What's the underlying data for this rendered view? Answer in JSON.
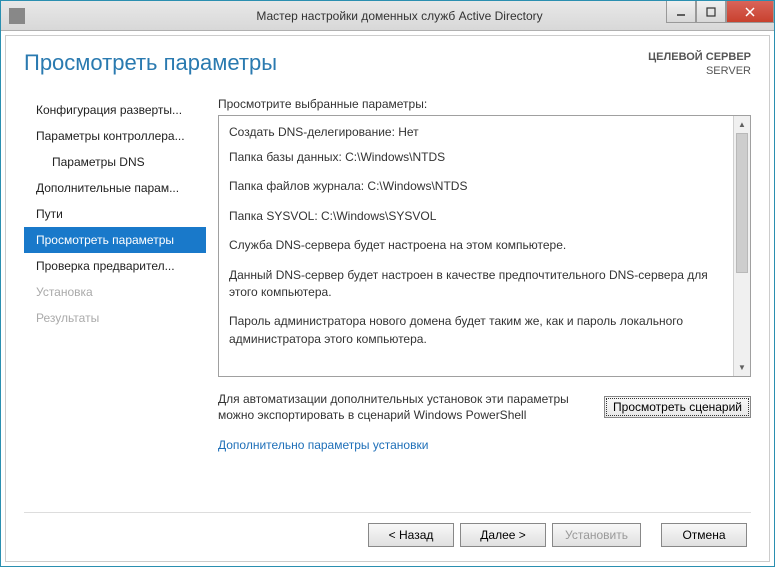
{
  "window": {
    "title": "Мастер настройки доменных служб Active Directory"
  },
  "header": {
    "page_title": "Просмотреть параметры",
    "target_label": "ЦЕЛЕВОЙ СЕРВЕР",
    "target_value": "SERVER"
  },
  "sidebar": {
    "items": [
      {
        "label": "Конфигурация разверты...",
        "indent": false,
        "state": "normal"
      },
      {
        "label": "Параметры контроллера...",
        "indent": false,
        "state": "normal"
      },
      {
        "label": "Параметры DNS",
        "indent": true,
        "state": "normal"
      },
      {
        "label": "Дополнительные парам...",
        "indent": false,
        "state": "normal"
      },
      {
        "label": "Пути",
        "indent": false,
        "state": "normal"
      },
      {
        "label": "Просмотреть параметры",
        "indent": false,
        "state": "selected"
      },
      {
        "label": "Проверка предварител...",
        "indent": false,
        "state": "normal"
      },
      {
        "label": "Установка",
        "indent": false,
        "state": "disabled"
      },
      {
        "label": "Результаты",
        "indent": false,
        "state": "disabled"
      }
    ]
  },
  "main": {
    "review_label": "Просмотрите выбранные параметры:",
    "lines": [
      "Создать DNS-делегирование: Нет",
      "Папка базы данных: C:\\Windows\\NTDS",
      "Папка файлов журнала: C:\\Windows\\NTDS",
      "Папка SYSVOL: C:\\Windows\\SYSVOL",
      "Служба DNS-сервера будет настроена на этом компьютере.",
      "Данный DNS-сервер будет настроен в качестве предпочтительного DNS-сервера для этого компьютера.",
      "Пароль администратора нового домена будет таким же, как и пароль локального администратора этого компьютера."
    ],
    "export_text": "Для автоматизации дополнительных установок эти параметры можно экспортировать в сценарий Windows PowerShell",
    "script_button": "Просмотреть сценарий",
    "extra_link": "Дополнительно параметры установки"
  },
  "buttons": {
    "back": "< Назад",
    "next": "Далее >",
    "install": "Установить",
    "cancel": "Отмена"
  }
}
